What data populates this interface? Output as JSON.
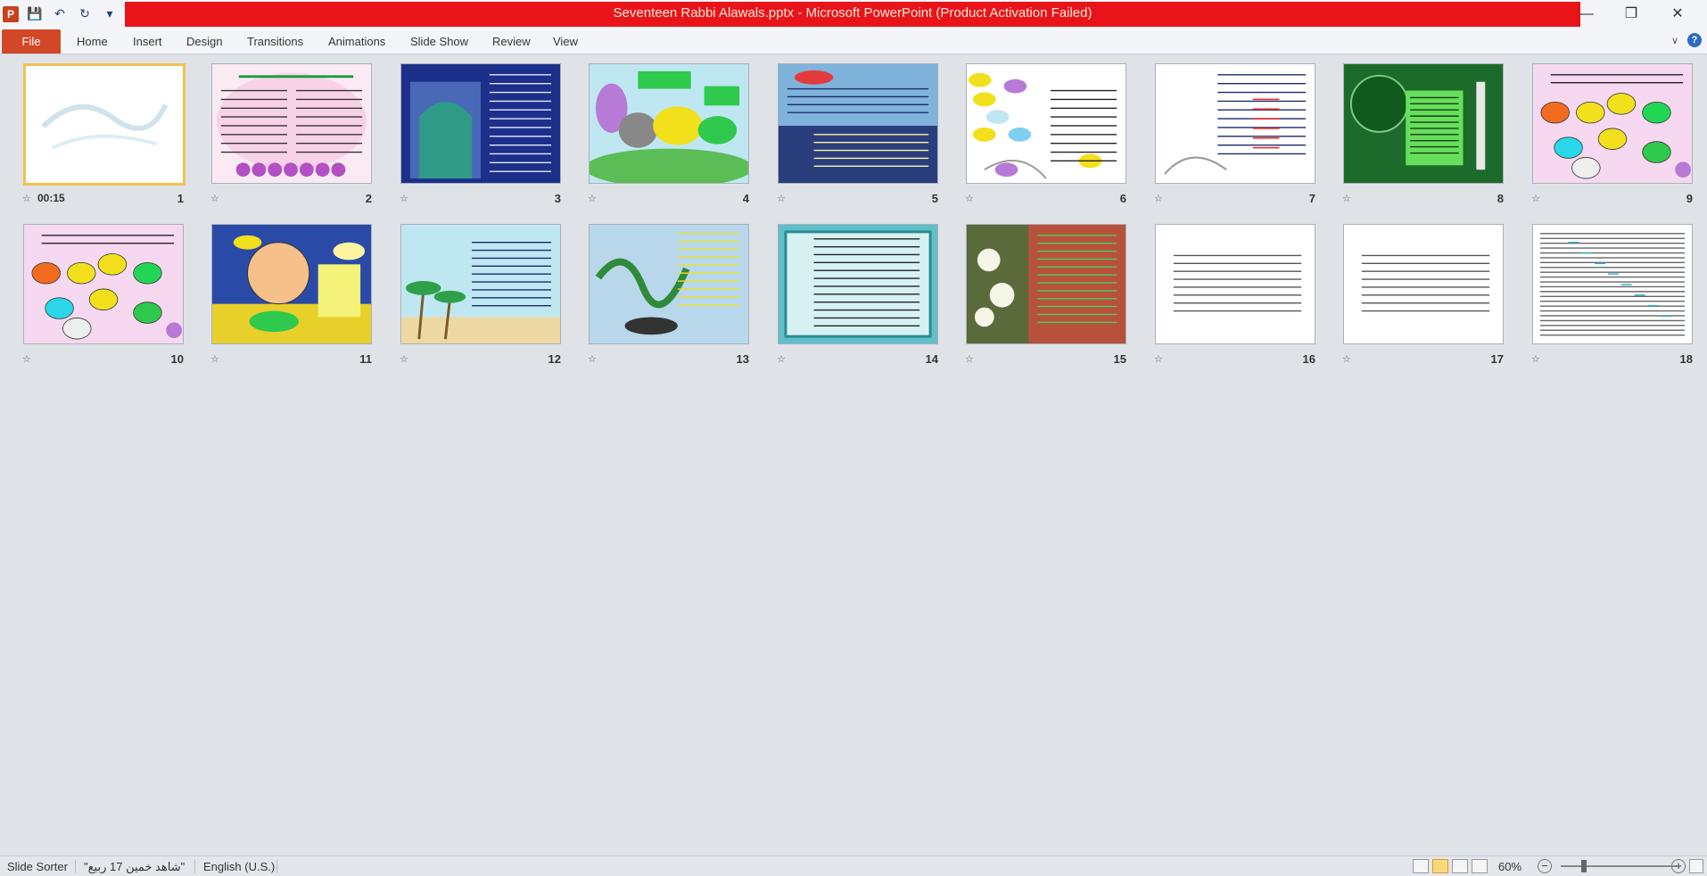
{
  "window": {
    "title": "Seventeen Rabbi Alawals.pptx - Microsoft PowerPoint (Product Activation Failed)",
    "minimize_icon": "minimize-icon",
    "restore_icon": "restore-icon",
    "close_icon": "close-icon"
  },
  "qat": {
    "app_letter": "P"
  },
  "ribbon": {
    "file": "File",
    "tabs": [
      "Home",
      "Insert",
      "Design",
      "Transitions",
      "Animations",
      "Slide Show",
      "Review",
      "View"
    ],
    "help": "?"
  },
  "slides": [
    {
      "num": "1",
      "timing": "00:15",
      "theme": "white"
    },
    {
      "num": "2",
      "theme": "pink"
    },
    {
      "num": "3",
      "theme": "mosque-blue"
    },
    {
      "num": "4",
      "theme": "lake"
    },
    {
      "num": "5",
      "theme": "sky"
    },
    {
      "num": "6",
      "theme": "white-bubbles"
    },
    {
      "num": "7",
      "theme": "white-text"
    },
    {
      "num": "8",
      "theme": "green"
    },
    {
      "num": "9",
      "theme": "pink-bubbles"
    },
    {
      "num": "10",
      "theme": "pink-bubbles"
    },
    {
      "num": "11",
      "theme": "field"
    },
    {
      "num": "12",
      "theme": "beach"
    },
    {
      "num": "13",
      "theme": "calligraphy"
    },
    {
      "num": "14",
      "theme": "teal-frame"
    },
    {
      "num": "15",
      "theme": "flowers"
    },
    {
      "num": "16",
      "theme": "plain"
    },
    {
      "num": "17",
      "theme": "plain"
    },
    {
      "num": "18",
      "theme": "dense-text"
    }
  ],
  "status": {
    "view": "Slide Sorter",
    "theme": "\"شاهد خمین 17 ربیع\"",
    "language": "English (U.S.)",
    "zoom": "60%",
    "zoom_fraction": 0.6
  },
  "colors": {
    "title_red": "#e8141a",
    "file_tab": "#d24726",
    "selected_border": "#f2c250"
  }
}
